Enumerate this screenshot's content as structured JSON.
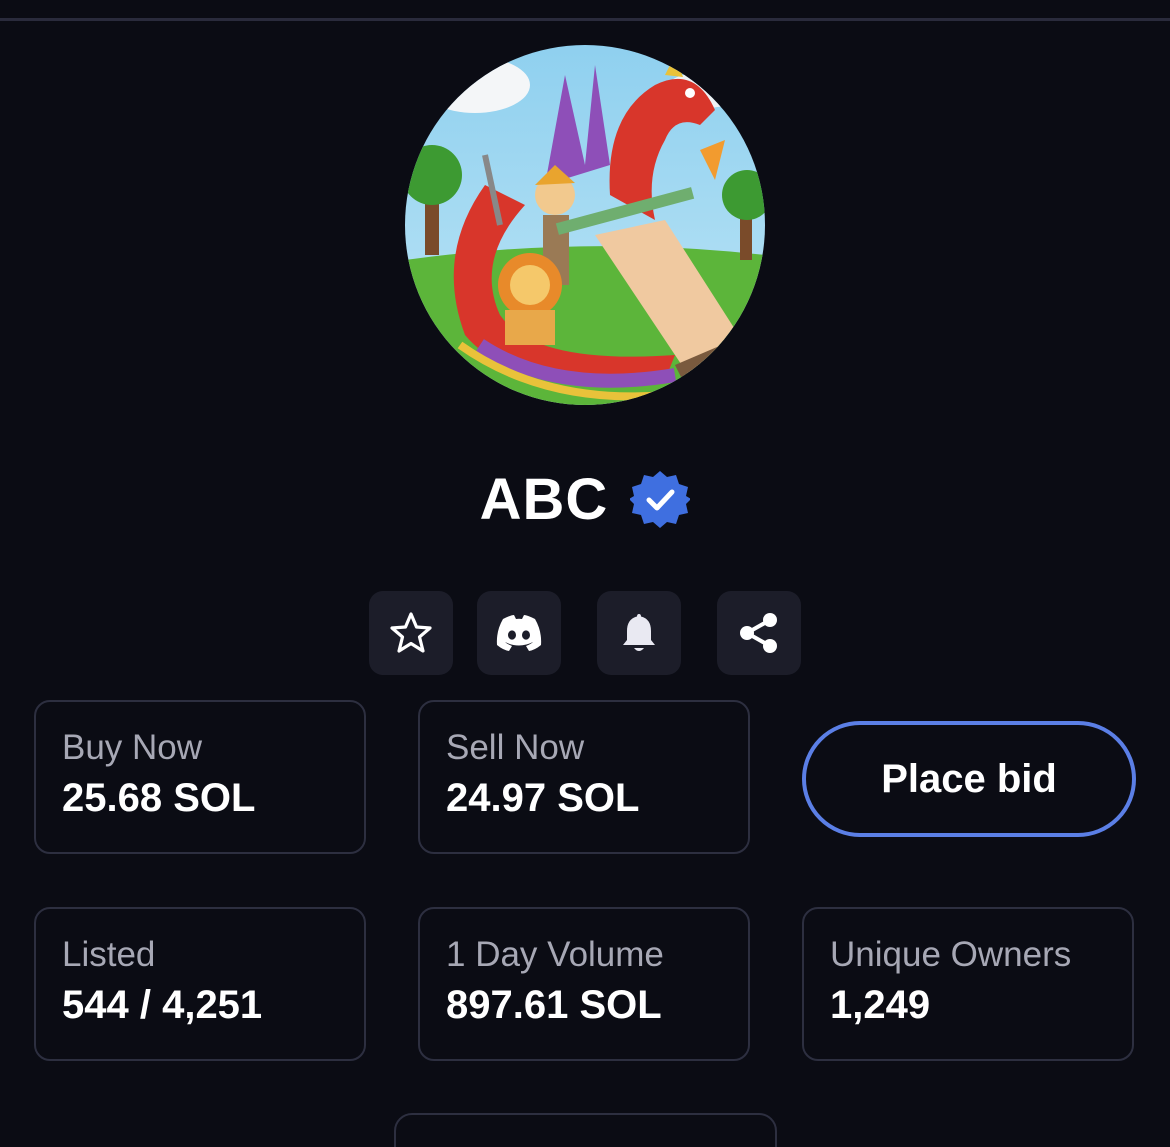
{
  "collection": {
    "name": "ABC",
    "avatar_icon": "dragon-knight-drawing",
    "verified_icon": "verified-badge-icon"
  },
  "actions": [
    {
      "name": "favorite",
      "icon": "star-icon"
    },
    {
      "name": "discord",
      "icon": "discord-icon"
    },
    {
      "name": "notifications",
      "icon": "bell-icon"
    },
    {
      "name": "share",
      "icon": "share-icon"
    }
  ],
  "stats": {
    "buy_now": {
      "label": "Buy Now",
      "value": "25.68 SOL"
    },
    "sell_now": {
      "label": "Sell Now",
      "value": "24.97 SOL"
    },
    "listed": {
      "label": "Listed",
      "value": "544 / 4,251"
    },
    "day_volume": {
      "label": "1 Day Volume",
      "value": "897.61 SOL"
    },
    "unique_owners": {
      "label": "Unique Owners",
      "value": "1,249"
    }
  },
  "place_bid": {
    "label": "Place bid"
  },
  "colors": {
    "background": "#0b0c14",
    "accent": "#5b7fe6",
    "verified": "#3f6fe0",
    "card_border": "#2d2f40"
  }
}
